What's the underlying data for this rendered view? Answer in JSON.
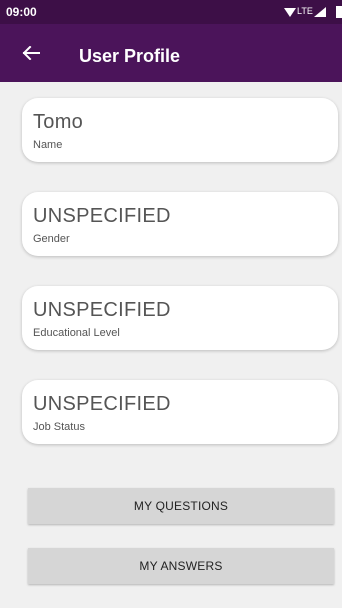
{
  "status_bar": {
    "time": "09:00",
    "network": "LTE",
    "icons": [
      "wifi-icon",
      "signal-icon",
      "battery-icon"
    ]
  },
  "app_bar": {
    "title": "User Profile",
    "back_icon": "arrow-left-icon",
    "color": "#4b145a"
  },
  "profile_fields": [
    {
      "value": "Tomo",
      "label": "Name"
    },
    {
      "value": "UNSPECIFIED",
      "label": "Gender"
    },
    {
      "value": "UNSPECIFIED",
      "label": "Educational Level"
    },
    {
      "value": "UNSPECIFIED",
      "label": "Job Status"
    }
  ],
  "actions": {
    "my_questions": "MY QUESTIONS",
    "my_answers": "MY ANSWERS"
  }
}
